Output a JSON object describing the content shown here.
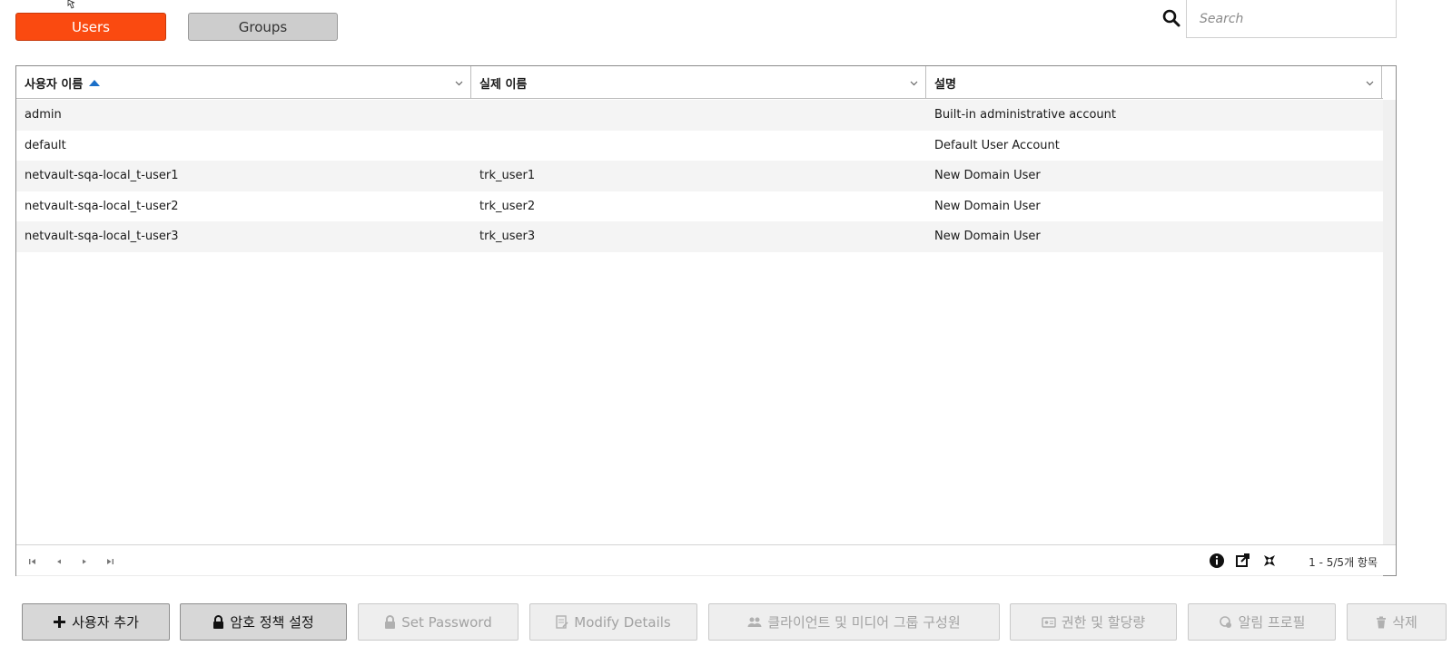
{
  "tabs": {
    "users_label": "Users",
    "groups_label": "Groups"
  },
  "search": {
    "placeholder": "Search"
  },
  "table": {
    "columns": [
      {
        "label": "사용자 이름",
        "sorted": "ascending"
      },
      {
        "label": "실제 이름"
      },
      {
        "label": "설명"
      }
    ],
    "rows": [
      {
        "username": "admin",
        "realname": "",
        "description": "Built-in administrative account"
      },
      {
        "username": "default",
        "realname": "",
        "description": "Default User Account"
      },
      {
        "username": "netvault-sqa-local_t-user1",
        "realname": "trk_user1",
        "description": "New Domain User"
      },
      {
        "username": "netvault-sqa-local_t-user2",
        "realname": "trk_user2",
        "description": "New Domain User"
      },
      {
        "username": "netvault-sqa-local_t-user3",
        "realname": "trk_user3",
        "description": "New Domain User"
      }
    ],
    "pager_info": "1 - 5/5개 항목"
  },
  "actions": {
    "add_user": "사용자 추가",
    "password_policy": "암호 정책 설정",
    "set_password": "Set Password",
    "modify_details": "Modify Details",
    "client_media_groups": "클라이언트 및 미디어 그룹 구성원",
    "privileges_quotas": "권한 및 할당량",
    "notification_profile": "알림 프로필",
    "delete": "삭제"
  },
  "colors": {
    "accent": "#fa4a10",
    "sort_arrow": "#1b6fc8"
  }
}
